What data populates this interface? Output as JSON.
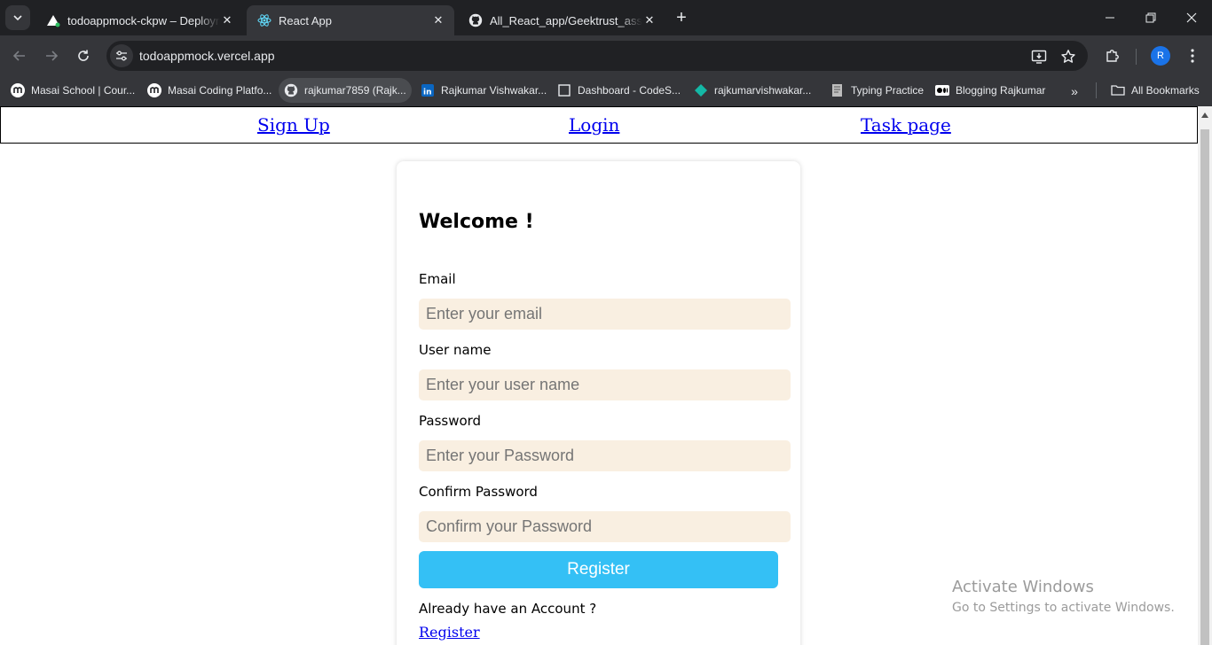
{
  "browser": {
    "tabs": [
      {
        "title": "todoappmock-ckpw – Deployment",
        "icon": "vercel-triangle-icon",
        "active": false
      },
      {
        "title": "React App",
        "icon": "react-atom-icon",
        "active": true
      },
      {
        "title": "All_React_app/Geektrust_assignment",
        "icon": "github-icon",
        "active": false
      }
    ],
    "url": "todoappmock.vercel.app",
    "avatar_letter": "R",
    "bookmarks": [
      {
        "label": "Masai School | Cour...",
        "icon": "masai-icon"
      },
      {
        "label": "Masai Coding Platfo...",
        "icon": "masai-icon"
      },
      {
        "label": "rajkumar7859 (Rajk...",
        "icon": "github-icon"
      },
      {
        "label": "Rajkumar Vishwakar...",
        "icon": "linkedin-icon"
      },
      {
        "label": "Dashboard - CodeS...",
        "icon": "page-icon"
      },
      {
        "label": "rajkumarvishwakar...",
        "icon": "diamond-icon"
      },
      {
        "label": "Typing Practice",
        "icon": "typing-icon"
      },
      {
        "label": "Blogging Rajkumar",
        "icon": "medium-icon"
      }
    ],
    "all_bookmarks": "All Bookmarks",
    "colors": {
      "frame": "#202124",
      "toolbar": "#35363a",
      "text": "#e8eaed"
    }
  },
  "page": {
    "nav": {
      "signup": "Sign Up",
      "login": "Login",
      "task": "Task page"
    },
    "card": {
      "title": "Welcome !",
      "email_label": "Email",
      "email_placeholder": "Enter your email",
      "username_label": "User name",
      "username_placeholder": "Enter your user name",
      "password_label": "Password",
      "password_placeholder": "Enter your Password",
      "confirm_label": "Confirm Password",
      "confirm_placeholder": "Confirm your Password",
      "register_button": "Register",
      "already_text": "Already have an Account ?",
      "register_link": "Register"
    },
    "colors": {
      "input_bg": "#f9efe1",
      "button_bg": "#34c0f5",
      "link": "#0000ee"
    }
  },
  "watermark": {
    "line1": "Activate Windows",
    "line2": "Go to Settings to activate Windows."
  }
}
